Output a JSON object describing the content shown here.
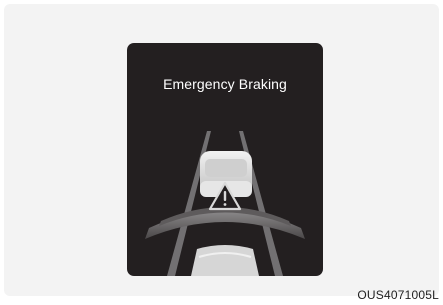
{
  "screen": {
    "title": "Emergency Braking",
    "warning_icon": "warning-triangle-icon",
    "colors": {
      "background": "#231f20",
      "road_lines": "#9a9898",
      "vehicle": "#d9d9d9",
      "warning_arc": "#7a7879"
    }
  },
  "caption": "OUS4071005L"
}
